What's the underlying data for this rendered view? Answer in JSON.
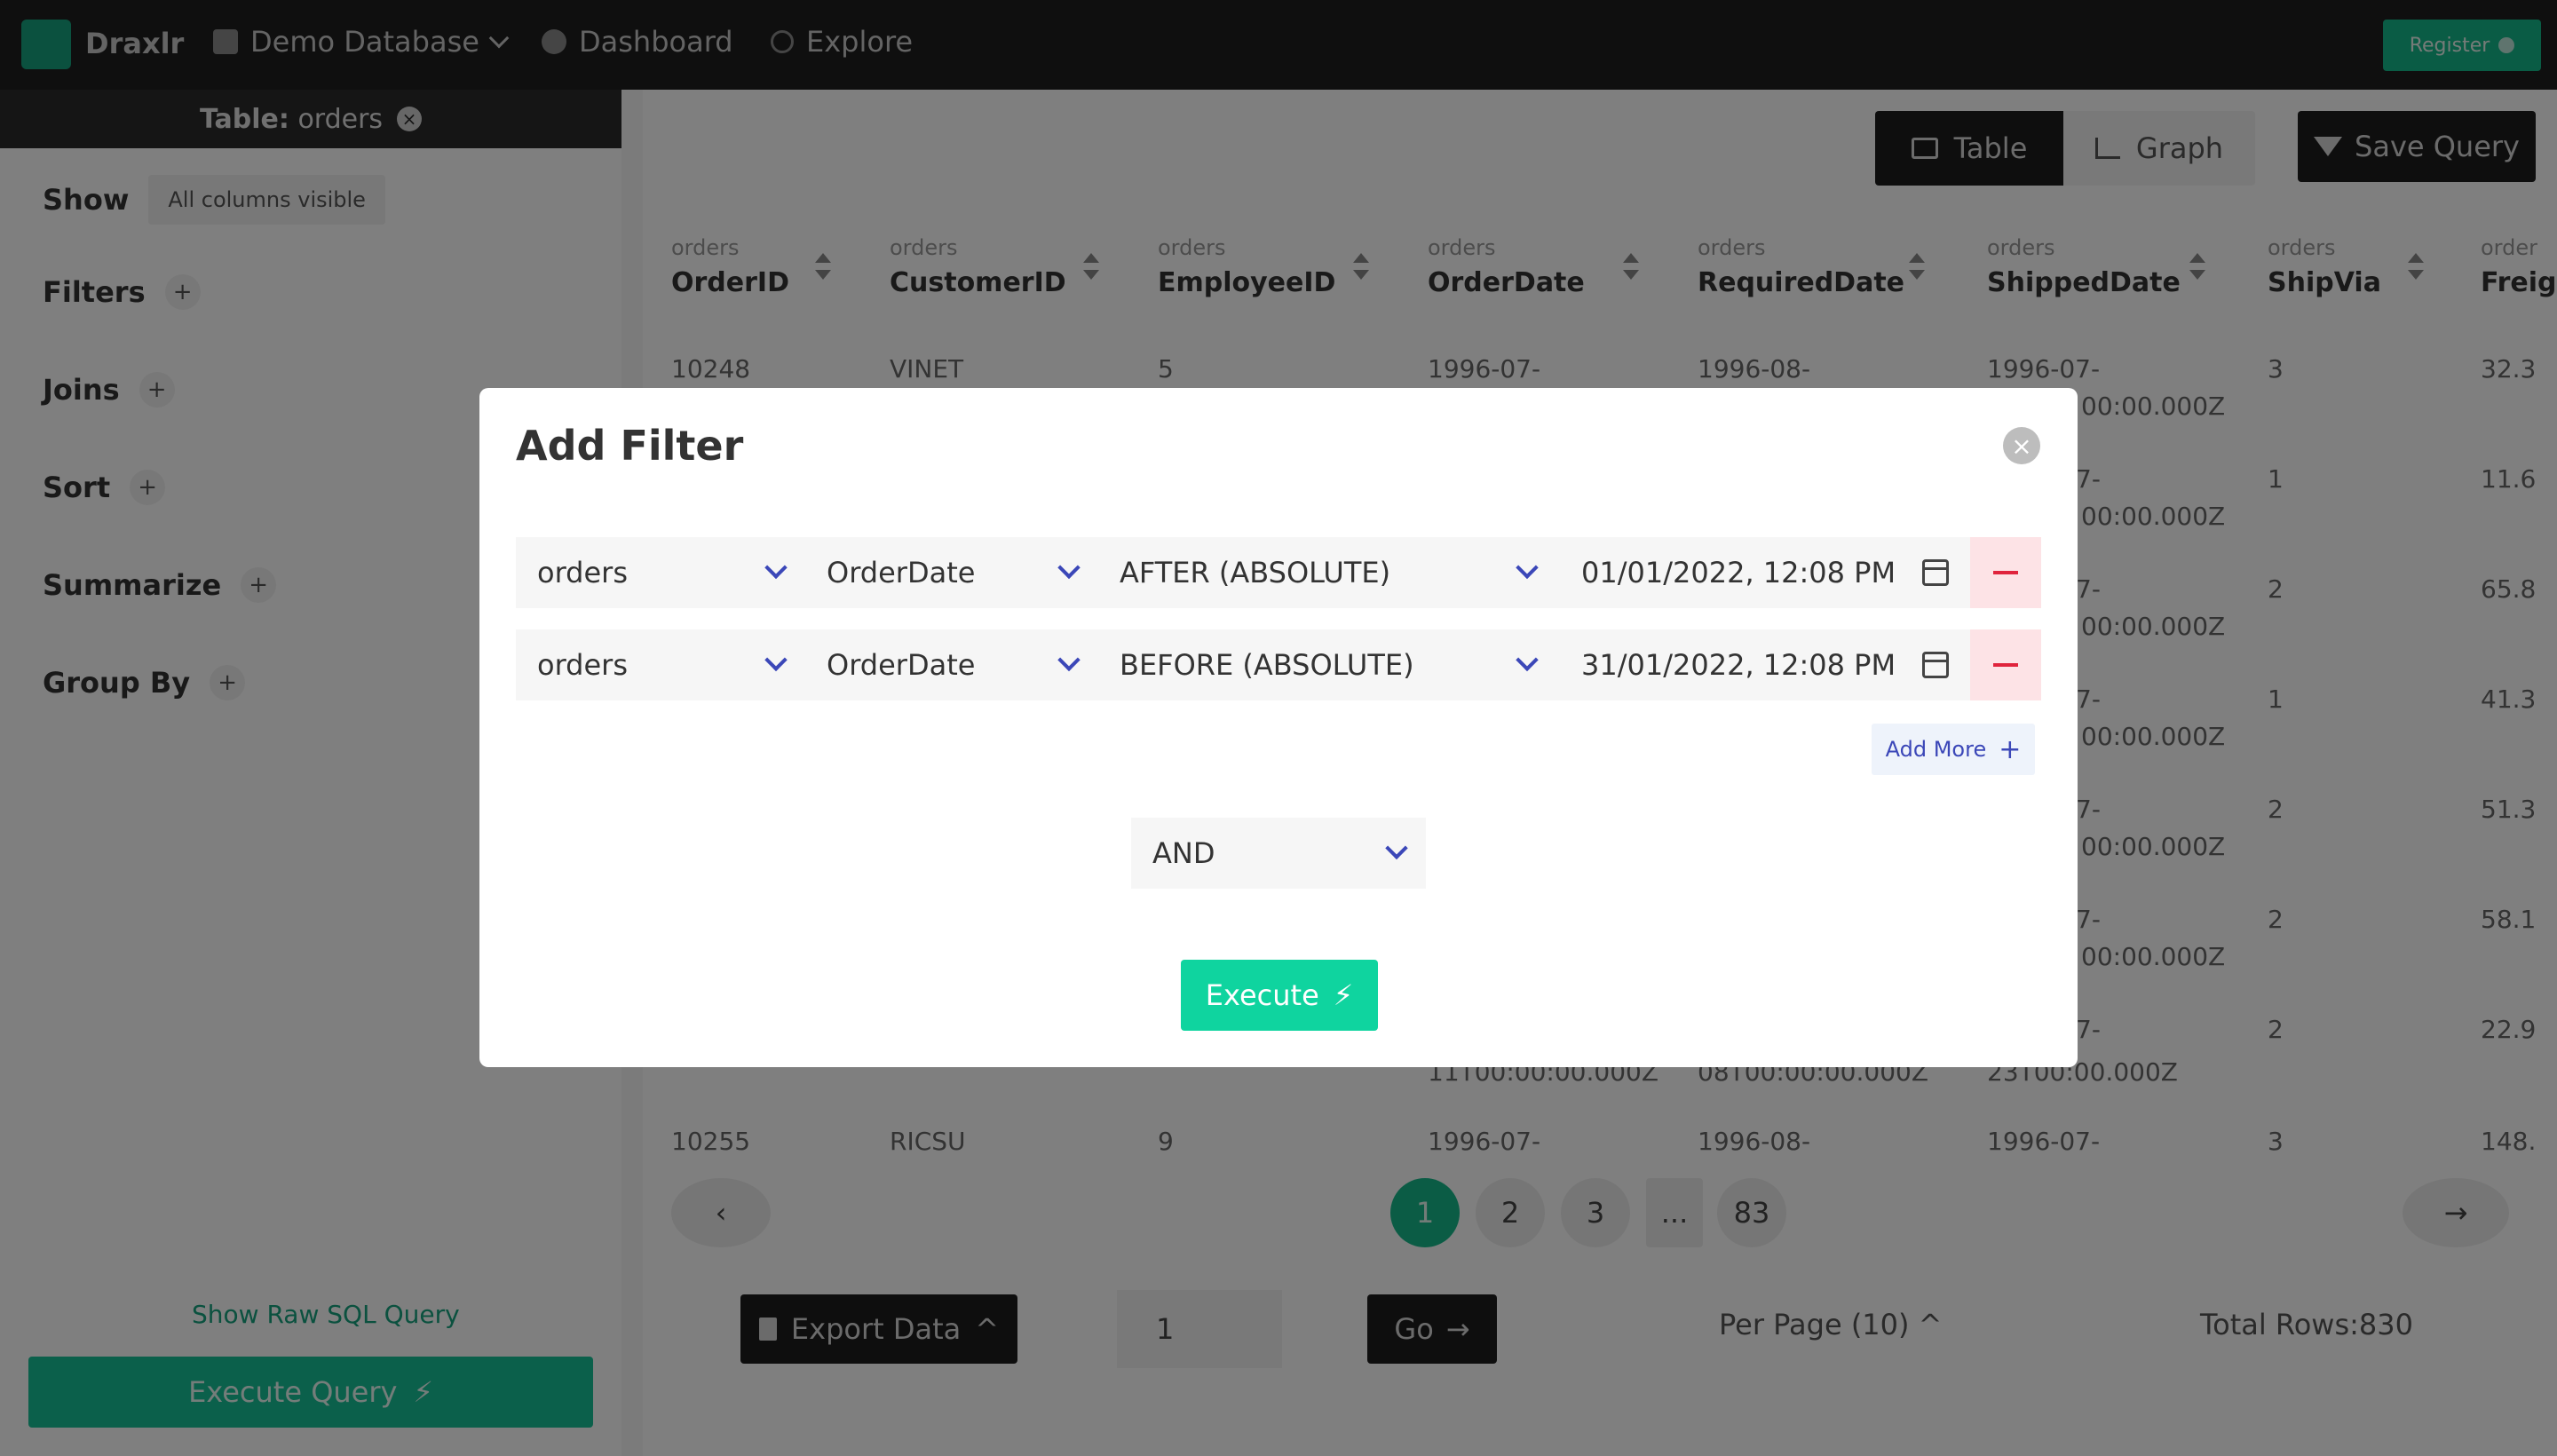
{
  "topbar": {
    "brand": "Draxlr",
    "database": "Demo Database",
    "dashboard": "Dashboard",
    "explore": "Explore",
    "register": "Register"
  },
  "sidebar": {
    "table_label": "Table:",
    "table_name": "orders",
    "show_label": "Show",
    "show_chip": "All columns visible",
    "filters_label": "Filters",
    "joins_label": "Joins",
    "sort_label": "Sort",
    "summarize_label": "Summarize",
    "group_by_label": "Group By",
    "plus": "+",
    "raw_sql": "Show Raw SQL Query",
    "execute_query": "Execute Query"
  },
  "main": {
    "view_table": "Table",
    "view_graph": "Graph",
    "save_query": "Save Query",
    "columns": [
      {
        "table": "orders",
        "name": "OrderID"
      },
      {
        "table": "orders",
        "name": "CustomerID"
      },
      {
        "table": "orders",
        "name": "EmployeeID"
      },
      {
        "table": "orders",
        "name": "OrderDate"
      },
      {
        "table": "orders",
        "name": "RequiredDate"
      },
      {
        "table": "orders",
        "name": "ShippedDate"
      },
      {
        "table": "orders",
        "name": "ShipVia"
      },
      {
        "table": "order",
        "name": "Freig"
      }
    ],
    "row_first": {
      "order_id": "10248",
      "customer": "VINET",
      "employee": "5",
      "order_date": "1996-07-",
      "required": "1996-08-",
      "shipped": "1996-07-",
      "ship_via": "3",
      "freight": "32.3"
    },
    "ship_vias": [
      "1",
      "2",
      "1",
      "2",
      "2",
      "2"
    ],
    "freights": [
      "11.6",
      "65.8",
      "41.3",
      "51.3",
      "58.1",
      "22.9"
    ],
    "shipped_suffix": "00:00.000Z",
    "shipped_short": "7-",
    "row_partial_order_date": "11T00:00:00.000Z",
    "row_partial_required": "08T00:00:00.000Z",
    "row_partial_shipped": "23T00:00.000Z",
    "row_last": {
      "order_id": "10255",
      "customer": "RICSU",
      "employee": "9",
      "order_date": "1996-07-",
      "required": "1996-08-",
      "shipped": "1996-07-",
      "ship_via": "3",
      "freight": "148."
    },
    "pages": [
      "1",
      "2",
      "3",
      "...",
      "83"
    ],
    "export": "Export Data",
    "page_value": "1",
    "go": "Go",
    "per_page": "Per Page (10)",
    "total_rows": "Total Rows:830"
  },
  "modal": {
    "title": "Add Filter",
    "filters": [
      {
        "table": "orders",
        "column": "OrderDate",
        "operator": "AFTER (ABSOLUTE)",
        "date": "01/01/2022, 12:08 PM"
      },
      {
        "table": "orders",
        "column": "OrderDate",
        "operator": "BEFORE (ABSOLUTE)",
        "date": "31/01/2022, 12:08 PM"
      }
    ],
    "add_more": "Add More",
    "conjunction": "AND",
    "execute": "Execute"
  },
  "colors": {
    "accent": "#0fd49f",
    "remove": "#e0243d",
    "chevron": "#3b47b8",
    "dark": "#1d1d1d"
  }
}
